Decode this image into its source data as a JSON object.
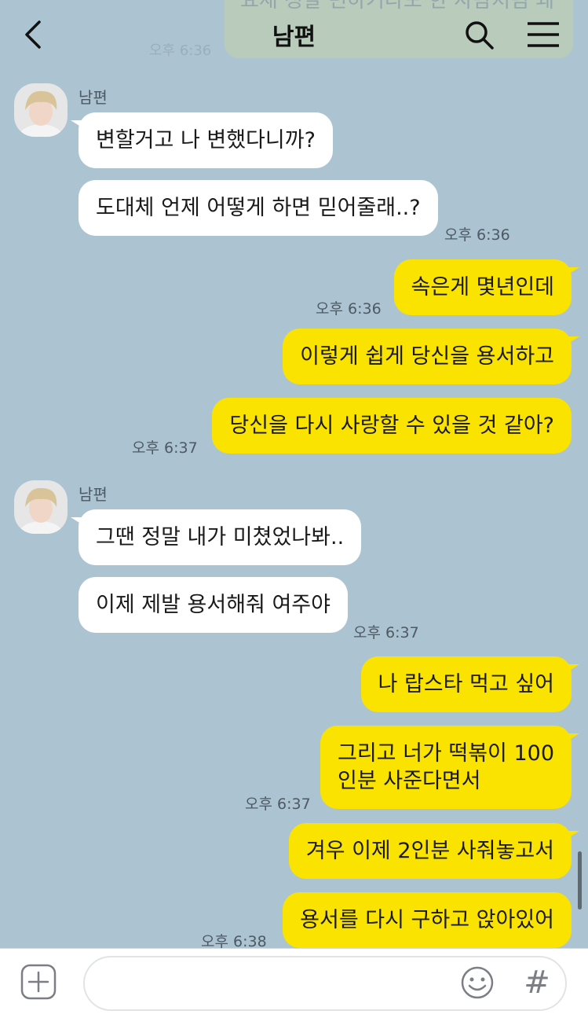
{
  "header": {
    "title": "남편",
    "ghost_text": "요새 정말 변하기라도 한 사람처럼\n왜",
    "ghost_time": "오후 6:36"
  },
  "groups": [
    {
      "sender": "남편",
      "messages": [
        "변할거고 나 변했다니까?",
        "도대체 언제 어떻게 하면 믿어줄래..?"
      ],
      "time": "오후 6:36"
    },
    {
      "sender": "me",
      "first": {
        "text": "속은게 몇년인데",
        "time": "오후 6:36"
      },
      "messages": [
        "이렇게 쉽게 당신을 용서하고",
        "당신을 다시 사랑할 수 있을 것 같아?"
      ],
      "time": "오후 6:37"
    },
    {
      "sender": "남편",
      "messages": [
        "그땐 정말 내가 미쳤었나봐..",
        "이제 제발 용서해줘 여주야"
      ],
      "time": "오후 6:37"
    },
    {
      "sender": "me",
      "messages": [
        "나 랍스타 먹고 싶어",
        "그리고 너가 떡볶이 100\n인분 사준다면서"
      ],
      "time": "오후 6:37"
    },
    {
      "sender": "me",
      "messages": [
        "겨우 이제 2인분 사줘놓고서",
        "용서를 다시 구하고 앉아있어"
      ],
      "time": "오후 6:38"
    }
  ],
  "input": {
    "placeholder": "",
    "value": ""
  },
  "colors": {
    "background": "#acc3d2",
    "outgoing": "#fbe300",
    "incoming": "#ffffff"
  },
  "icons": [
    "back-icon",
    "search-icon",
    "menu-icon",
    "plus-icon",
    "emoji-icon",
    "hash-icon"
  ]
}
